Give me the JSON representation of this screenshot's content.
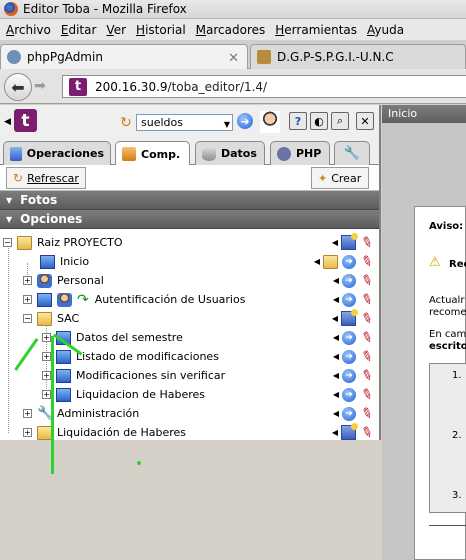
{
  "window": {
    "title": "Editor Toba - Mozilla Firefox"
  },
  "menu": [
    "Archivo",
    "Editar",
    "Ver",
    "Historial",
    "Marcadores",
    "Herramientas",
    "Ayuda"
  ],
  "browser_tabs": [
    {
      "label": "phpPgAdmin",
      "active": true
    },
    {
      "label": "D.G.P-S.P.G.I.-U.N.C",
      "active": false
    }
  ],
  "address": {
    "host": "200.16.30.9",
    "path": "/toba_editor/1.4/"
  },
  "editor": {
    "project_select": "sueldos",
    "tabs": [
      "Operaciones",
      "Comp.",
      "Datos",
      "PHP"
    ],
    "refresh_label": "Refrescar",
    "create_label": "Crear",
    "sections": [
      "Fotos",
      "Opciones"
    ],
    "tree": [
      {
        "label": "Raiz PROYECTO"
      },
      {
        "label": "Inicio"
      },
      {
        "label": "Personal"
      },
      {
        "label": "Autentificación de Usuarios"
      },
      {
        "label": "SAC"
      },
      {
        "label": "Datos del semestre"
      },
      {
        "label": "Listado de modificaciones"
      },
      {
        "label": "Modificaciones sin verificar"
      },
      {
        "label": "Liquidacion de Haberes"
      },
      {
        "label": "Administración"
      },
      {
        "label": "Liquidación de Haberes"
      }
    ]
  },
  "right": {
    "top": "Inicio",
    "aviso": "Aviso:",
    "warning": "Rec",
    "line1": "Actualr",
    "line2": "recome",
    "line3": "En cam",
    "line4": "escrito",
    "list": [
      "1.",
      "2.",
      "3."
    ]
  }
}
